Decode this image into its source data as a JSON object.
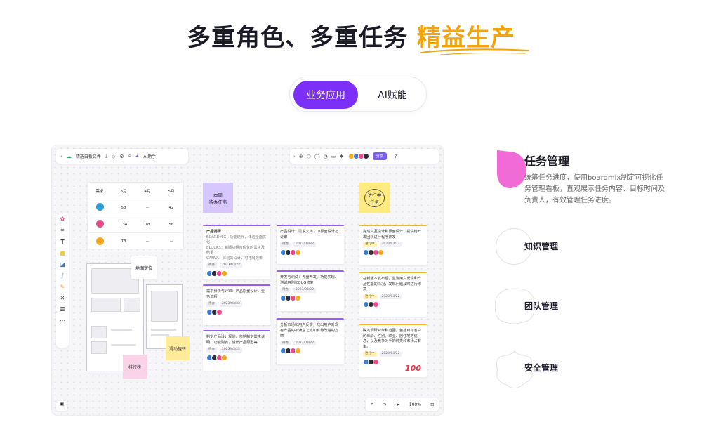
{
  "headline": {
    "main": "多重角色、多重任务",
    "accent": "精益生产"
  },
  "tabs": [
    {
      "label": "业务应用",
      "active": true
    },
    {
      "label": "AI赋能",
      "active": false
    }
  ],
  "colors": {
    "brand_purple": "#7b2ff7",
    "accent_yellow": "#f2a40a",
    "feature_pink": "#f06bd6"
  },
  "board": {
    "topbar": {
      "file_name": "精选白板文件",
      "ai_label": "AI助手",
      "share_label": "分享"
    },
    "table": {
      "headers": [
        "需求",
        "3月",
        "4月",
        "5月"
      ],
      "rows": [
        [
          "58",
          "--",
          "42"
        ],
        [
          "134",
          "78",
          "56"
        ],
        [
          "73",
          "--",
          "--"
        ]
      ]
    },
    "sticky_map": "地图定位",
    "sticky_slide": "滑动旋转",
    "sticky_rank": "排行榜",
    "col_todo": "本周\n待办任务",
    "col_doing": "进行中\n任务",
    "todo_cards": [
      {
        "title": "产品调研",
        "bullets": [
          "BOARDMIX：功能迭代，体验全面优化",
          "BLOCKS：新版块组合优化的需求及结果",
          "CANVA：体验的设计，可拓展效果"
        ],
        "status": "待办",
        "date": "2023/03/22"
      },
      {
        "title": "需求分析与评审：产品原型设计，业务流程",
        "status": "待办",
        "date": "2023/03/22"
      },
      {
        "title": "制定产品设计规划，包括制定需求说明，功能列表，设计产品原型等",
        "status": "待办",
        "date": "2023/03/22"
      }
    ],
    "mid_cards": [
      {
        "title": "产品设计：需求文档、UI界面设计与评审",
        "status": "待办",
        "date": "2023/03/22"
      },
      {
        "title": "开发与测试：界面开发、功能实现、测试用例和BUG修复",
        "status": "待办",
        "date": "2023/03/22"
      },
      {
        "title": "分析市场和用户反馈，找出用户对现有产品的不满意之处和有待改进的方面",
        "status": "待办",
        "date": "2023/03/22"
      }
    ],
    "doing_cards": [
      {
        "title": "完成交互设计和界面设计，提供给开发团队进行程序开发",
        "status": "进行中",
        "date": "2023/03/22"
      },
      {
        "title": "在新版本发布后，监测用户反馈和产品性能的情况，发现问题及时进行修复",
        "status": "进行中",
        "date": "2023/03/22"
      },
      {
        "title": "确定调研对象和范围，包括目标客户的年龄、性别、职业、居住地等信息，以及竞争对手的种类和市场占有率。",
        "status": "进行中",
        "date": "2023/03/22"
      }
    ],
    "stamp": "100",
    "zoom": "100%"
  },
  "features": [
    {
      "title": "任务管理",
      "desc": "统筹任务进度，使用boardmix制定可视化任务管理看板，直观展示任务内容、目标时间及负责人，有效管理任务进度。",
      "active": true
    },
    {
      "title": "知识管理",
      "active": false
    },
    {
      "title": "团队管理",
      "active": false
    },
    {
      "title": "安全管理",
      "active": false
    }
  ]
}
